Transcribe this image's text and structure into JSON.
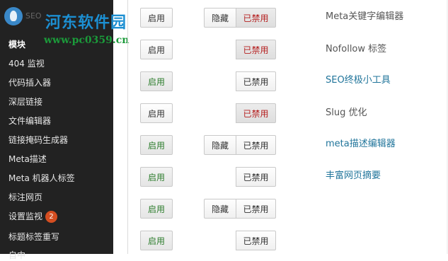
{
  "watermark": {
    "title": "河东软件园",
    "url": "www.pc0359.cn",
    "ghost_label": "SEO"
  },
  "sidebar": {
    "items": [
      {
        "label": "模块",
        "current": true
      },
      {
        "label": "404 监视"
      },
      {
        "label": "代码插入器"
      },
      {
        "label": "深层链接"
      },
      {
        "label": "文件编辑器"
      },
      {
        "label": "链接掩码生成器"
      },
      {
        "label": "Meta描述"
      },
      {
        "label": "Meta 机器人标签"
      },
      {
        "label": "标注网页"
      },
      {
        "label": "设置监视",
        "badge": "2"
      },
      {
        "label": "标题标签重写"
      },
      {
        "label": "自中"
      }
    ]
  },
  "buttons": {
    "enable": "启用",
    "hide": "隐藏",
    "disabled": "已禁用"
  },
  "modules": [
    {
      "name": "Meta关键字编辑器",
      "enabled": false,
      "has_hide": true,
      "disabled_active": true,
      "name_style": "plain"
    },
    {
      "name": "Nofollow 标签",
      "enabled": false,
      "has_hide": false,
      "disabled_active": true,
      "name_style": "plain"
    },
    {
      "name": "SEO终极小工具",
      "enabled": true,
      "has_hide": false,
      "disabled_active": false,
      "name_style": "link"
    },
    {
      "name": "Slug 优化",
      "enabled": false,
      "has_hide": false,
      "disabled_active": true,
      "name_style": "plain"
    },
    {
      "name": "meta描述编辑器",
      "enabled": true,
      "has_hide": true,
      "disabled_active": false,
      "name_style": "link"
    },
    {
      "name": "丰富网页摘要",
      "enabled": true,
      "has_hide": false,
      "disabled_active": false,
      "name_style": "link"
    },
    {
      "enabled": true,
      "has_hide": true,
      "disabled_active": false
    },
    {
      "enabled": true,
      "has_hide": false,
      "disabled_active": false
    }
  ]
}
